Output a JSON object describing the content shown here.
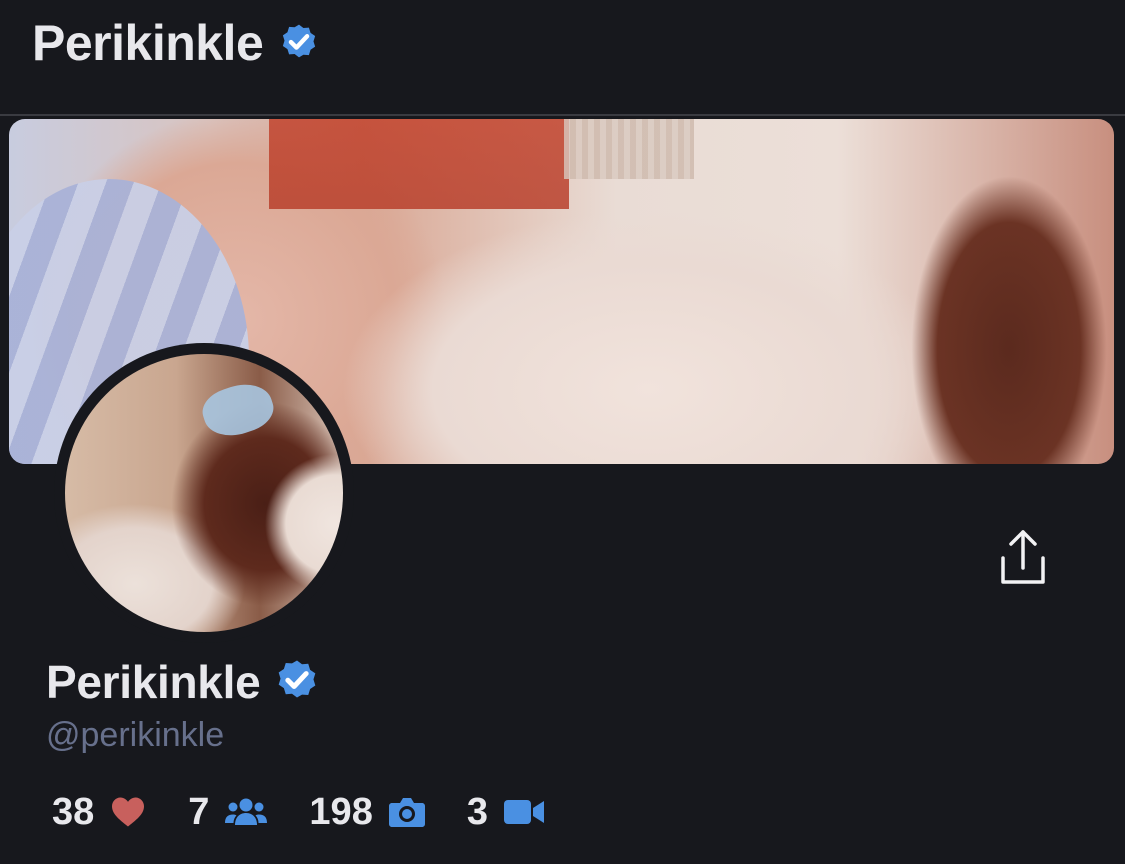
{
  "header": {
    "title": "Perikinkle",
    "verified_icon": "verified-badge-icon"
  },
  "profile": {
    "name": "Perikinkle",
    "handle": "@perikinkle",
    "verified_icon": "verified-badge-icon"
  },
  "actions": {
    "share_icon": "share-upload-icon"
  },
  "stats": [
    {
      "value": "38",
      "icon": "heart-icon",
      "color": "#c8605d"
    },
    {
      "value": "7",
      "icon": "users-icon",
      "color": "#4a90e2"
    },
    {
      "value": "198",
      "icon": "camera-icon",
      "color": "#4a90e2"
    },
    {
      "value": "3",
      "icon": "video-icon",
      "color": "#4a90e2"
    }
  ],
  "colors": {
    "background": "#17181d",
    "accent": "#4a90e2",
    "heart": "#c8605d",
    "handle": "#67708c"
  }
}
